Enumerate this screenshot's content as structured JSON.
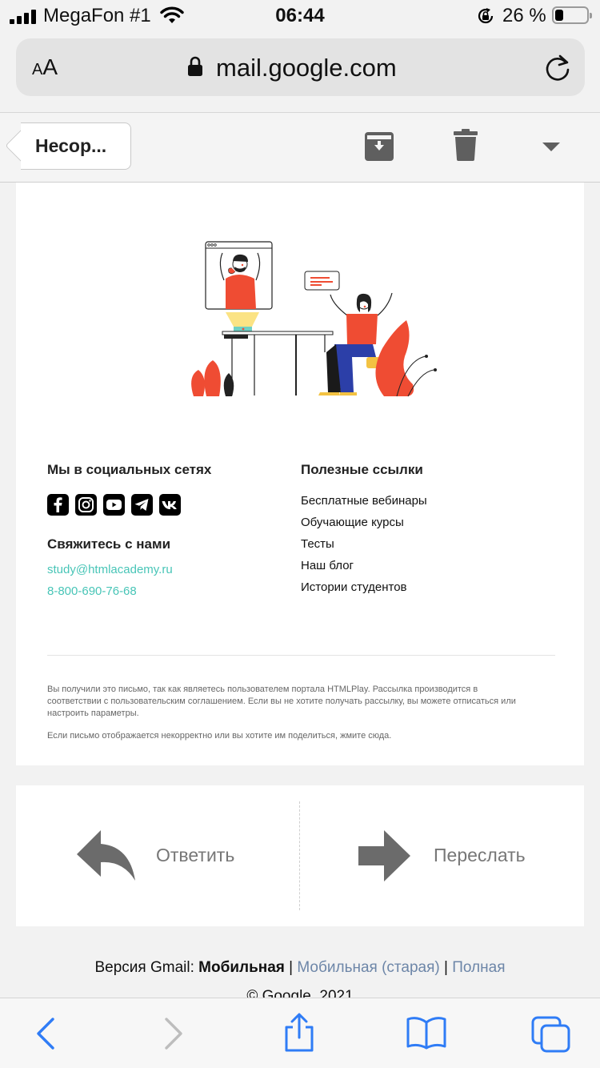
{
  "status_bar": {
    "carrier": "MegaFon #1",
    "time": "06:44",
    "battery_percent": "26 %",
    "battery_level": 0.26
  },
  "browser": {
    "text_size_label_small": "A",
    "text_size_label_large": "A",
    "url": "mail.google.com"
  },
  "toolbar": {
    "back_label": "Несор..."
  },
  "email": {
    "social": {
      "title": "Мы в социальных сетях",
      "icons": [
        "facebook-icon",
        "instagram-icon",
        "youtube-icon",
        "telegram-icon",
        "vk-icon"
      ]
    },
    "contact": {
      "title": "Свяжитесь с нами",
      "email": "study@htmlacademy.ru",
      "phone": "8-800-690-76-68"
    },
    "links": {
      "title": "Полезные ссылки",
      "items": [
        "Бесплатные вебинары",
        "Обучающие курсы",
        "Тесты",
        "Наш блог",
        "Истории студентов"
      ]
    },
    "fine_print": "Вы получили это письмо, так как являетесь пользователем портала HTMLPlay. Рассылка производится в соответствии с пользовательским соглашением. Если вы не хотите получать рассылку, вы можете отписаться или настроить параметры.",
    "fine_print_2": "Если письмо отображается некорректно или вы хотите им поделиться, жмите сюда."
  },
  "actions": {
    "reply_label": "Ответить",
    "forward_label": "Переслать"
  },
  "footer": {
    "version_prefix": "Версия Gmail:",
    "version_current": "Мобильная",
    "sep1": "|",
    "version_old": "Мобильная (старая)",
    "sep2": "|",
    "version_full": "Полная",
    "copyright": "© Google, 2021"
  },
  "colors": {
    "accent_teal": "#48c5b7",
    "illustration_red": "#ef4c33",
    "link_blue": "#6d86a8",
    "safari_blue": "#2f7cf6"
  }
}
